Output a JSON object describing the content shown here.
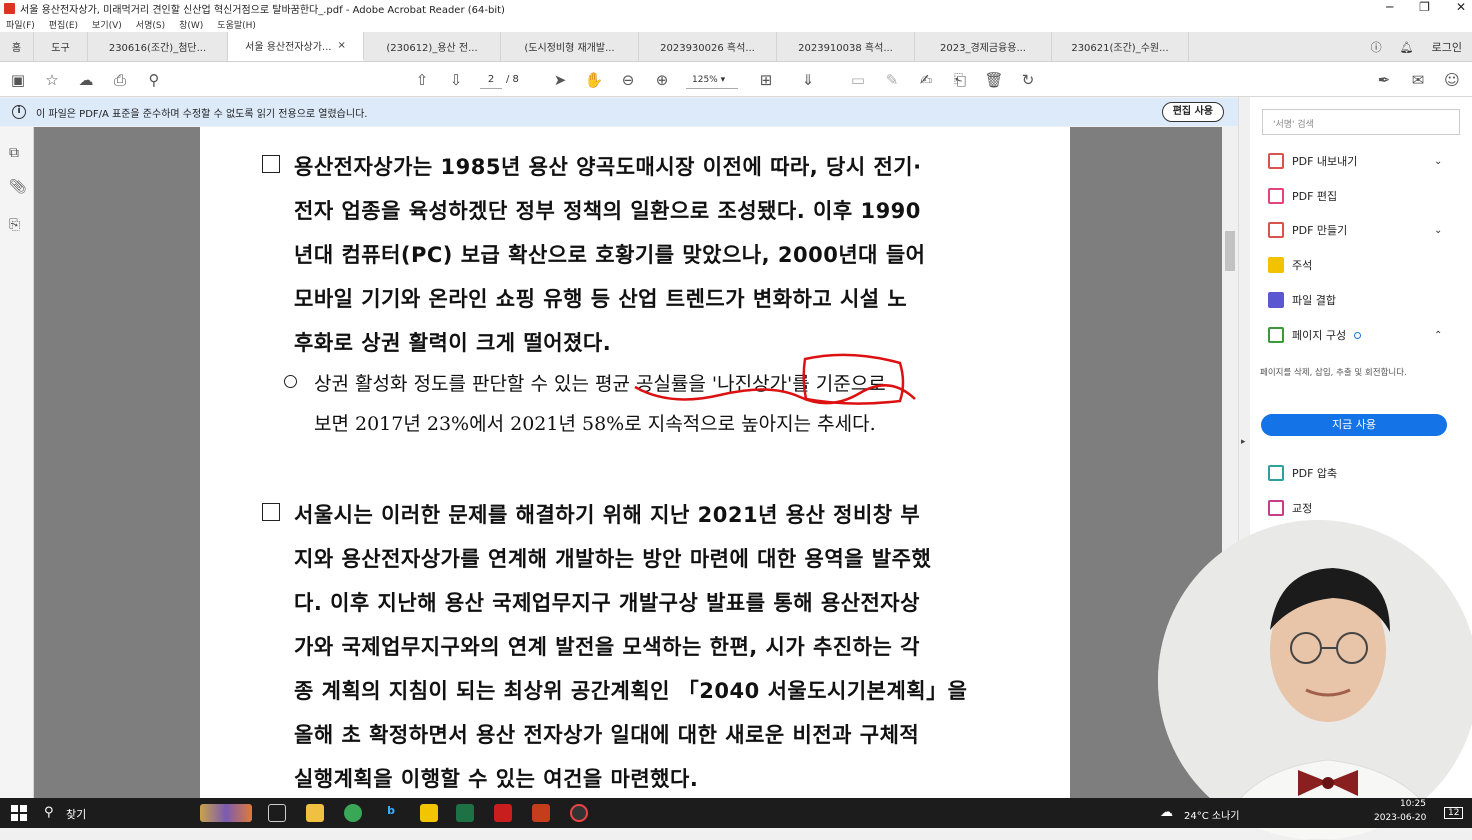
{
  "window": {
    "title": "서울 용산전자상가, 미래먹거리 견인할 신산업 혁신거점으로 탈바꿈한다_.pdf - Adobe Acrobat Reader (64-bit)",
    "controls": [
      "─",
      "❐",
      "✕"
    ]
  },
  "menu": [
    "파일(F)",
    "편집(E)",
    "보기(V)",
    "서명(S)",
    "창(W)",
    "도움말(H)"
  ],
  "tabs": {
    "home": "홈",
    "tools": "도구",
    "docs": [
      "230616(조간)_첨단...",
      "서울 용산전자상가...",
      "(230612)_용산 전...",
      "(도시정비형 재개발...",
      "2023930026 흑석...",
      "2023910038 흑석...",
      "2023_경제금융용...",
      "230621(조간)_수원..."
    ],
    "active_index": 1,
    "close_glyph": "×",
    "login": "로그인"
  },
  "toolbar": {
    "page_current": "2",
    "page_total": "/ 8",
    "zoom": "125%"
  },
  "infobar": {
    "message": "이 파일은 PDF/A 표준을 준수하며 수정할 수 없도록 읽기 전용으로 열렸습니다.",
    "edit_button": "편집 사용"
  },
  "document": {
    "para1": [
      "용산전자상가는 1985년 용산 양곡도매시장 이전에 따라, 당시 전기·",
      "전자 업종을 육성하겠단 정부 정책의 일환으로 조성됐다. 이후 1990",
      "년대 컴퓨터(PC) 보급 확산으로 호황기를 맞았으나, 2000년대 들어",
      "모바일 기기와 온라인 쇼핑 유행 등 산업 트렌드가 변화하고 시설 노",
      "후화로 상권 활력이 크게 떨어졌다."
    ],
    "sub1": [
      "상권 활성화 정도를 판단할 수 있는 평균 공실률을 '나진상가'를 기준으로",
      "보면 2017년 23%에서 2021년 58%로 지속적으로 높아지는 추세다."
    ],
    "para2": [
      "서울시는 이러한 문제를 해결하기 위해 지난 2021년 용산 정비창 부",
      "지와 용산전자상가를 연계해 개발하는 방안 마련에 대한 용역을 발주했",
      "다. 이후 지난해 용산 국제업무지구 개발구상 발표를 통해 용산전자상",
      "가와 국제업무지구와의 연계 발전을 모색하는 한편, 시가 추진하는 각",
      "종 계획의 지침이 되는 최상위 공간계획인 「2040 서울도시기본계획」을",
      "올해 초 확정하면서 용산 전자상가 일대에 대한 새로운 비전과 구체적",
      "실행계획을 이행할 수 있는 여건을 마련했다."
    ]
  },
  "sidebar": {
    "search_placeholder": "'서명' 검색",
    "items": [
      {
        "label": "PDF 내보내기",
        "color": "#d9534f",
        "chevron": "⌄"
      },
      {
        "label": "PDF 편집",
        "color": "#e0457b",
        "chevron": ""
      },
      {
        "label": "PDF 만들기",
        "color": "#d9534f",
        "chevron": "⌄"
      },
      {
        "label": "주석",
        "color": "#f2c200",
        "chevron": ""
      },
      {
        "label": "파일 결합",
        "color": "#5b57d1",
        "chevron": ""
      },
      {
        "label": "페이지 구성",
        "color": "#3a9a3a",
        "chevron": "⌃"
      }
    ],
    "description": "페이지를 삭제, 삽입, 추출 및 회전합니다.",
    "use_button": "지금 사용",
    "more_items": [
      {
        "label": "PDF 압축",
        "color": "#2f9fa0"
      },
      {
        "label": "교정",
        "color": "#c63d8a"
      }
    ]
  },
  "taskbar": {
    "search_label": "찾기",
    "weather": "24°C 소나기",
    "time": "10:25",
    "date": "2023-06-20",
    "notification_count": "12"
  }
}
